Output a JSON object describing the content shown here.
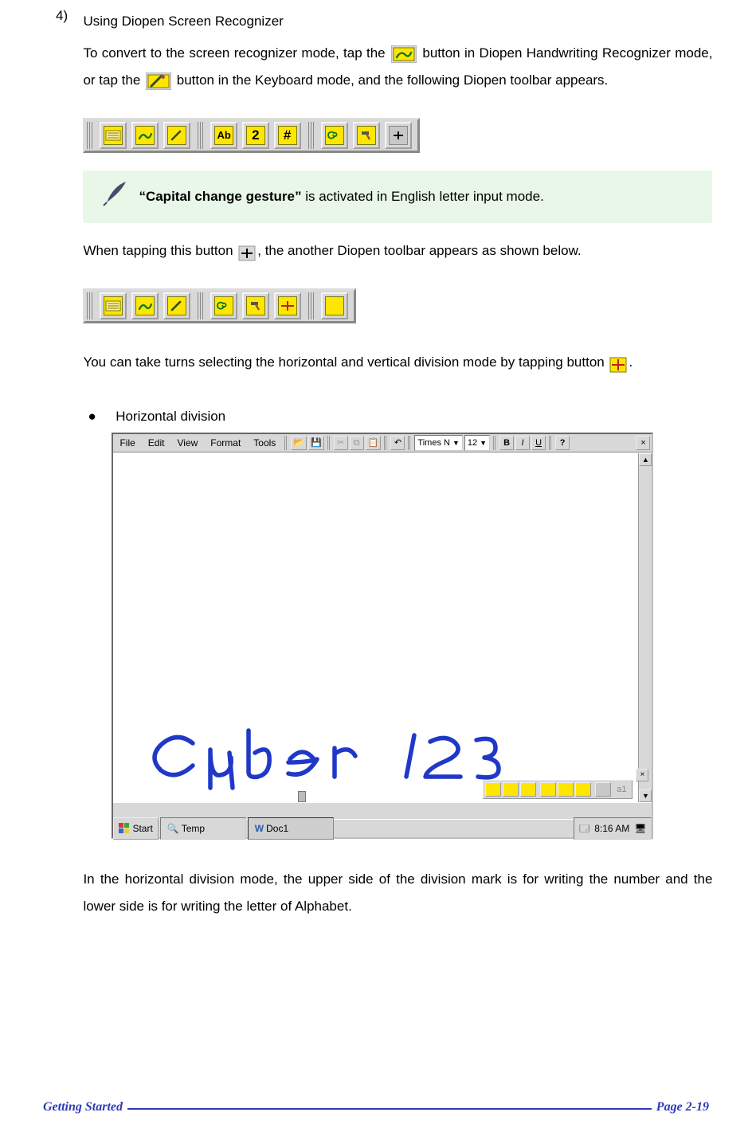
{
  "section": {
    "num": "4)",
    "title": "Using Diopen Screen Recognizer"
  },
  "p1": {
    "a": "To convert to the screen recognizer mode, tap the",
    "b": " button in Diopen Handwriting Recognizer mode, or tap the ",
    "c": "button in the Keyboard mode, and the following Diopen toolbar appears."
  },
  "note": {
    "bold": "“Capital change gesture”",
    "rest": " is activated in English letter input mode."
  },
  "p2": {
    "a": "When tapping this button ",
    "b": ", the another Diopen toolbar appears as shown below."
  },
  "p3": {
    "a": "You can take turns selecting the horizontal and vertical division mode by tapping button ",
    "b": "."
  },
  "bullet": {
    "dot": "●",
    "label": "Horizontal division"
  },
  "toolbar1": {
    "items": [
      "kbd",
      "hand",
      "pen",
      "Ab",
      "2",
      "#",
      "sep",
      "spiral",
      "hammer",
      "plus"
    ]
  },
  "toolbar2": {
    "items": [
      "kbd",
      "hand",
      "pen",
      "sep",
      "spiral",
      "hammer",
      "div",
      "sep",
      "blank"
    ]
  },
  "sshot": {
    "menu": [
      "File",
      "Edit",
      "View",
      "Format",
      "Tools"
    ],
    "font": "Times N",
    "size": "12",
    "handwriting": "Cyber   123",
    "mini_a1": "a1",
    "taskbar": {
      "start": "Start",
      "temp": "Temp",
      "doc": "Doc1",
      "time": "8:16 AM"
    }
  },
  "p4": "In the horizontal division mode, the upper side of the division mark is for writing the number and the lower side is for writing the letter of Alphabet.",
  "footer": {
    "left": "Getting Started",
    "right": "Page 2-19"
  }
}
